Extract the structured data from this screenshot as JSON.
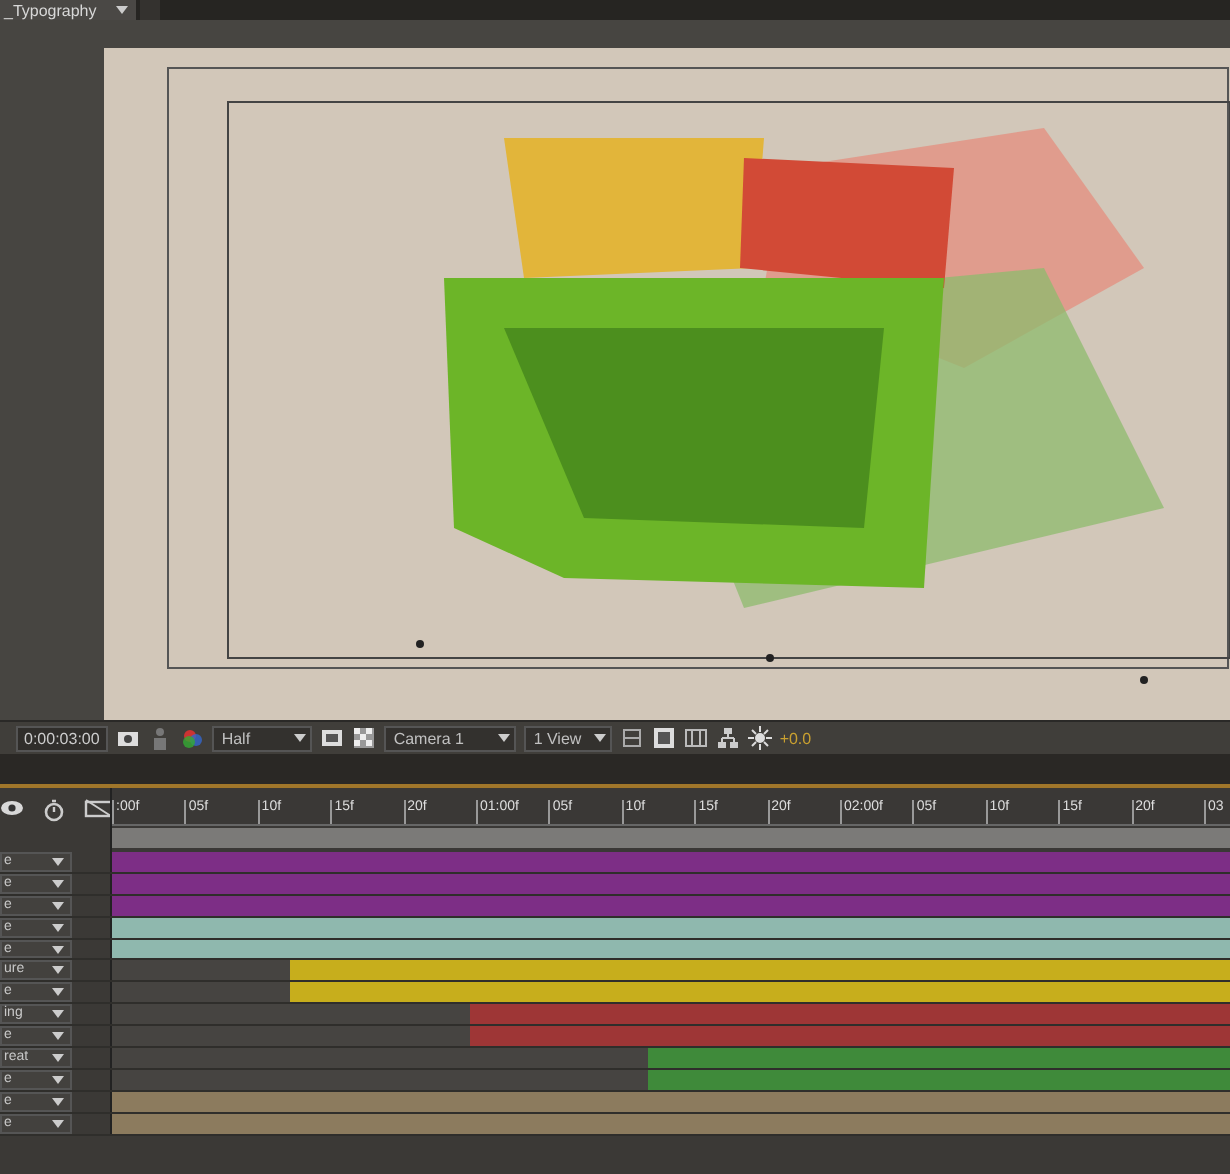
{
  "tab": {
    "title": "_Typography"
  },
  "viewer_toolbar": {
    "timecode": "0:00:03:00",
    "resolution": "Half",
    "camera": "Camera 1",
    "views": "1 View",
    "exposure": "+0.0"
  },
  "ruler": {
    "ticks": [
      ":00f",
      "05f",
      "10f",
      "15f",
      "20f",
      "01:00f",
      "05f",
      "10f",
      "15f",
      "20f",
      "02:00f",
      "05f",
      "10f",
      "15f",
      "20f",
      "03"
    ]
  },
  "layers": [
    {
      "name": "e",
      "color": "#7d2e86",
      "level": 1
    },
    {
      "name": "e",
      "color": "#7d2e86",
      "level": 1
    },
    {
      "name": "e",
      "color": "#7d2e86",
      "level": 1
    },
    {
      "name": "e",
      "color": "#8fb8ae",
      "level": 1
    },
    {
      "name": "e",
      "color": "#8fb8ae",
      "level": 1
    },
    {
      "name": "ure",
      "color": "#c7ae1c",
      "level": 0.84
    },
    {
      "name": "e",
      "color": "#c7ae1c",
      "level": 0.84
    },
    {
      "name": "ing",
      "color": "#9e3636",
      "level": 0.68
    },
    {
      "name": "e",
      "color": "#9e3636",
      "level": 0.68
    },
    {
      "name": "reat",
      "color": "#3f8a3a",
      "level": 0.52
    },
    {
      "name": "e",
      "color": "#3f8a3a",
      "level": 0.52
    },
    {
      "name": "e",
      "color": "#8c7b5e",
      "level": 1
    },
    {
      "name": "e",
      "color": "#8c7b5e",
      "level": 1
    }
  ]
}
